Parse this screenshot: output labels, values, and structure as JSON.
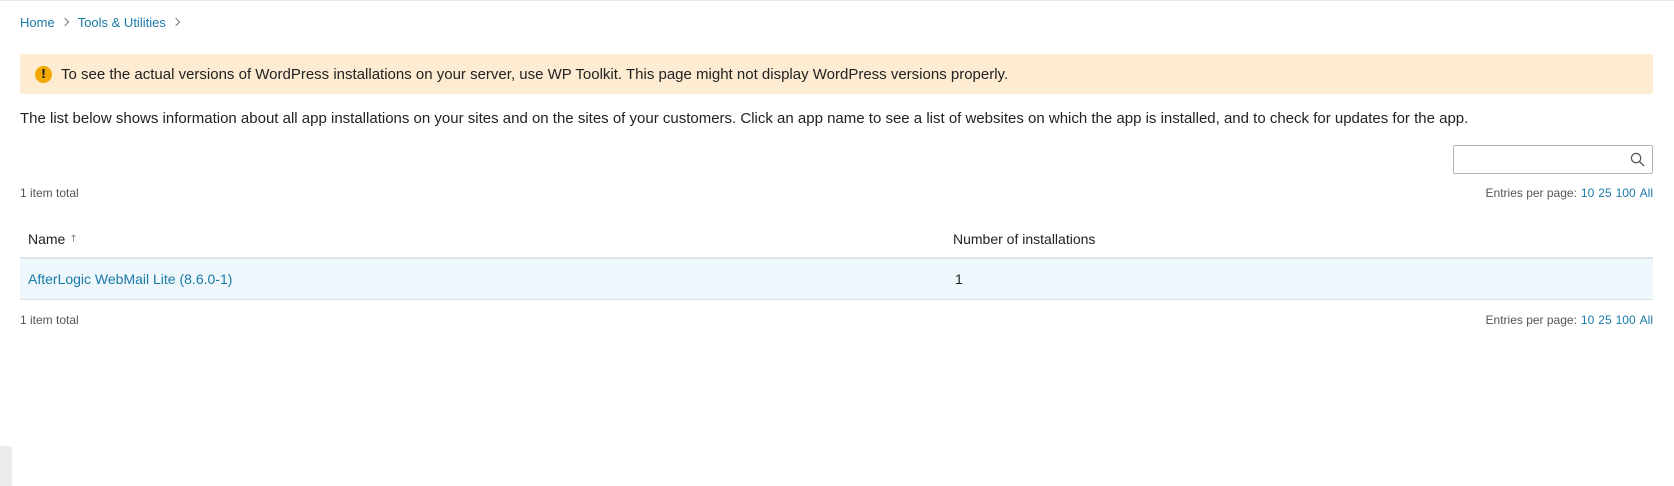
{
  "breadcrumb": {
    "items": [
      "Home",
      "Tools & Utilities"
    ]
  },
  "alert": {
    "text": "To see the actual versions of WordPress installations on your server, use WP Toolkit. This page might not display WordPress versions properly.",
    "color": "#fdecd2",
    "icon": "warning-icon"
  },
  "intro": {
    "text": "The list below shows information about all app installations on your sites and on the sites of your customers. Click an app name to see a list of websites on which the app is installed, and to check for updates for the app."
  },
  "search": {
    "value": "",
    "placeholder": "",
    "icon": "search-icon"
  },
  "pager_top": {
    "total": "1 item total",
    "label": "Entries per page:",
    "options": [
      "10",
      "25",
      "100",
      "All"
    ]
  },
  "pager_bottom": {
    "total": "1 item total",
    "label": "Entries per page:",
    "options": [
      "10",
      "25",
      "100",
      "All"
    ]
  },
  "table": {
    "columns": [
      "Name",
      "Number of installations"
    ],
    "sort_icon": "↑",
    "rows": [
      {
        "name": "AfterLogic WebMail Lite (8.6.0-1)",
        "count": "1"
      }
    ]
  },
  "colors": {
    "link": "#1a7aa8",
    "row_highlight": "#eef7fc"
  }
}
